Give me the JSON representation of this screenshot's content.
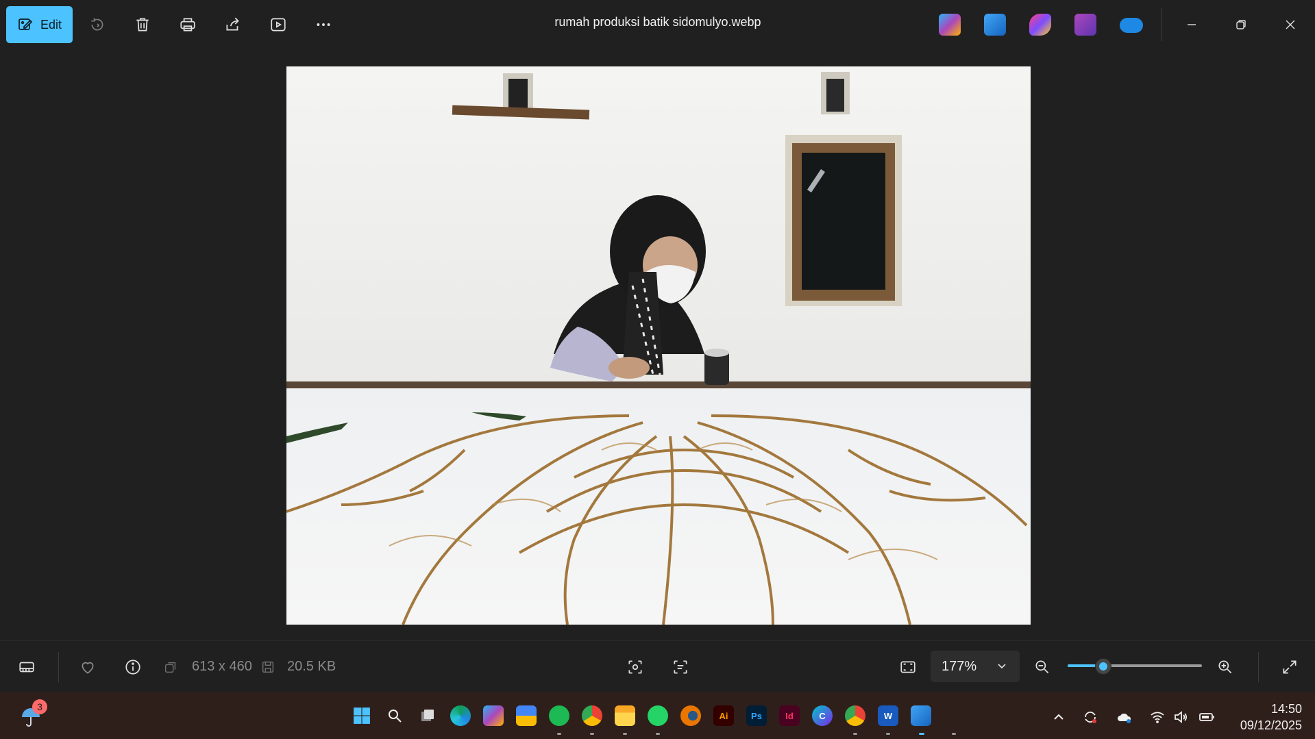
{
  "toolbar": {
    "edit_label": "Edit",
    "tools": [
      "rotate-icon",
      "delete-icon",
      "print-icon",
      "share-icon",
      "slideshow-icon",
      "more-icon"
    ]
  },
  "window": {
    "title": "rumah produksi batik sidomulyo.webp"
  },
  "top_apps": [
    "copilot",
    "photos-edit",
    "clipchamp-gradient",
    "clipchamp",
    "onedrive"
  ],
  "statusbar": {
    "dimensions": "613 x 460",
    "file_size": "20.5 KB",
    "zoom_value": "177%",
    "zoom_fraction": 0.26
  },
  "taskbar": {
    "weather_badge": "3",
    "apps": [
      {
        "name": "start",
        "label": ""
      },
      {
        "name": "search",
        "label": ""
      },
      {
        "name": "task-view",
        "label": ""
      },
      {
        "name": "edge",
        "label": ""
      },
      {
        "name": "copilot",
        "label": ""
      },
      {
        "name": "store",
        "label": ""
      },
      {
        "name": "spotify",
        "label": ""
      },
      {
        "name": "chrome",
        "label": ""
      },
      {
        "name": "file-explorer",
        "label": ""
      },
      {
        "name": "whatsapp",
        "label": ""
      },
      {
        "name": "blender",
        "label": ""
      },
      {
        "name": "illustrator",
        "label": "Ai"
      },
      {
        "name": "photoshop",
        "label": "Ps"
      },
      {
        "name": "indesign",
        "label": "Id"
      },
      {
        "name": "canva",
        "label": "C"
      },
      {
        "name": "chrome-profile",
        "label": ""
      },
      {
        "name": "word",
        "label": "W"
      },
      {
        "name": "photos",
        "label": ""
      }
    ],
    "time": "14:50",
    "date": "09/12/2025"
  },
  "colors": {
    "accent": "#4cc2ff",
    "background": "#202020",
    "taskbar": "#2f1f1b"
  }
}
